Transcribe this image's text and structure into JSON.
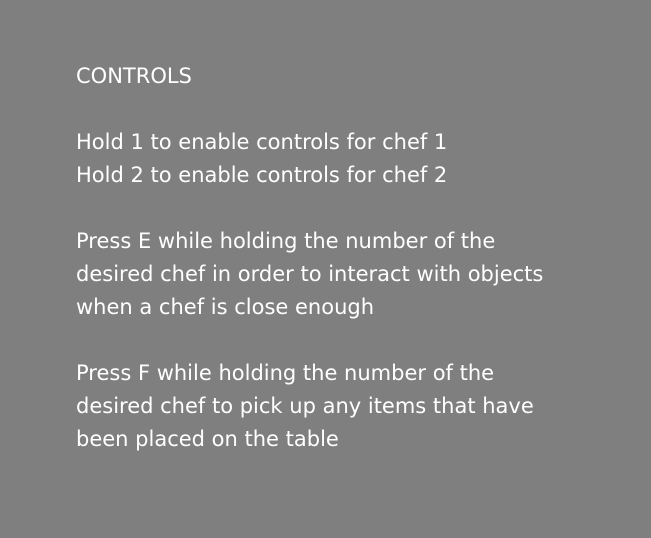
{
  "screen": {
    "background": "#7f7f7f",
    "text_color": "#ffffff",
    "title": "CONTROLS",
    "sections": [
      {
        "lines": [
          "Hold 1 to enable controls for chef 1",
          "Hold 2 to enable controls for chef 2"
        ]
      },
      {
        "lines": [
          "Press E while holding the number of the",
          "desired chef in order to interact with objects",
          "when a chef is close enough"
        ]
      },
      {
        "lines": [
          "Press F while holding the number of the",
          "desired chef to pick up any items that have",
          "been placed on the table"
        ]
      }
    ]
  }
}
